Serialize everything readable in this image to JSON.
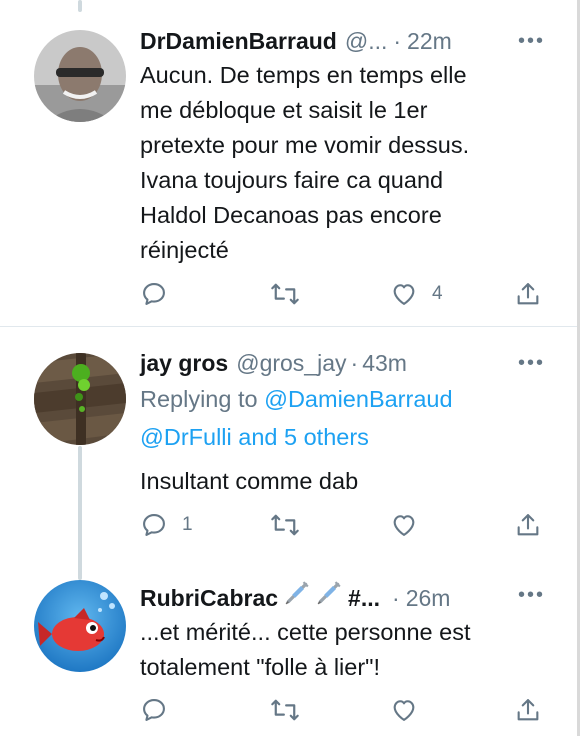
{
  "tweets": [
    {
      "name": "DrDamienBarraud",
      "handle": "@...",
      "time": "22m",
      "text": [
        "Aucun. De temps en temps elle",
        "me débloque et saisit le 1er",
        "pretexte pour me vomir dessus.",
        "Ivana toujours faire ca quand",
        "Haldol Decanoas pas encore",
        "réinjecté"
      ],
      "reply_count": "",
      "retweet_count": "",
      "like_count": "4"
    },
    {
      "name": "jay gros",
      "handle": "@gros_jay",
      "time": "43m",
      "replying_prefix": "Replying to",
      "replying_user": "@DamienBarraud",
      "replying_others": "@DrFulli and 5 others",
      "text": [
        "Insultant comme dab"
      ],
      "reply_count": "1",
      "retweet_count": "",
      "like_count": ""
    },
    {
      "name": "RubriCabrac",
      "name_suffix": "#...",
      "handle": "",
      "time": "26m",
      "text": [
        "...et mérité... cette personne est",
        "totalement \"folle à lier\"!"
      ],
      "reply_count": "",
      "retweet_count": "",
      "like_count": ""
    }
  ],
  "separator": "·",
  "more_glyph": "•••",
  "icons": [
    "reply-icon",
    "retweet-icon",
    "like-icon",
    "share-icon",
    "syringe-icon",
    "more-icon"
  ],
  "colors": {
    "text": "#14171a",
    "muted": "#657786",
    "link": "#1da1f2",
    "divider": "#e1e8ed"
  }
}
